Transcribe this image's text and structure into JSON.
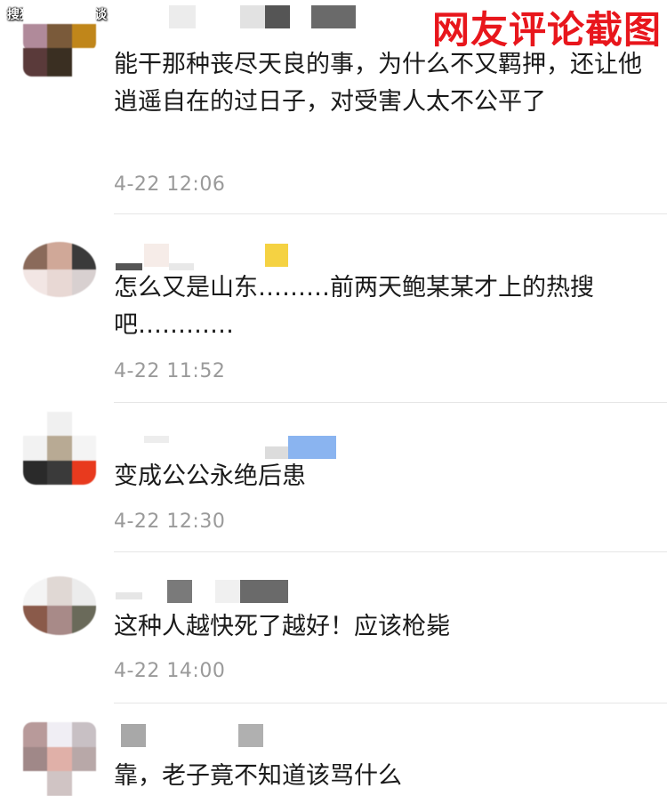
{
  "watermark": "搜狐号@阿尔闲谈",
  "banner_title": "网友评论截图",
  "comments": [
    {
      "text": "能干那种丧尽天良的事，为什么不又羁押，还让他逍遥自在的过日子，对受害人太不公平了",
      "time": "4-22 12:06"
    },
    {
      "text": "怎么又是山东………前两天鲍某某才上的热搜吧…………",
      "time": "4-22 11:52"
    },
    {
      "text": "变成公公永绝后患",
      "time": "4-22 12:30"
    },
    {
      "text": "这种人越快死了越好！应该枪毙",
      "time": "4-22 14:00"
    },
    {
      "text": "靠，老子竟不知道该骂什么",
      "time": ""
    }
  ],
  "colors": {
    "banner": "#e8161c",
    "time": "#9a9a9a",
    "text": "#1a1a1a"
  }
}
